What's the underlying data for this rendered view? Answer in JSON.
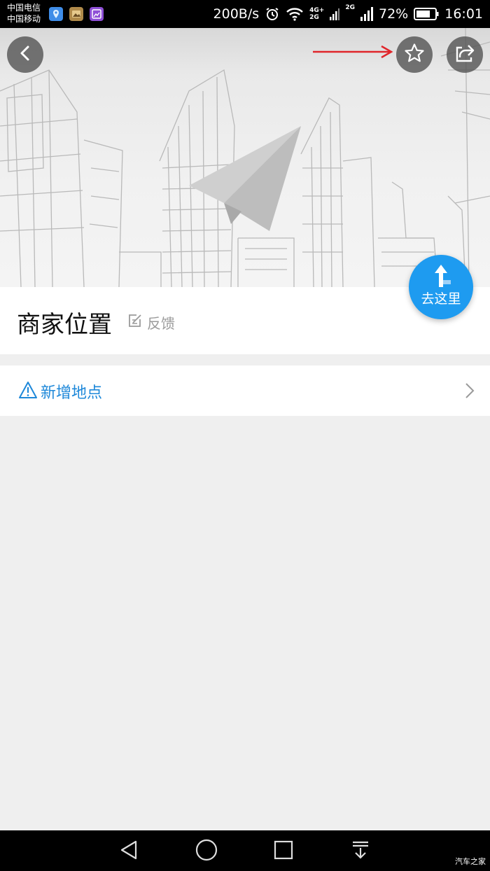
{
  "status_bar": {
    "carrier_1": "中国电信",
    "carrier_2": "中国移动",
    "net_speed": "200B/s",
    "net_4g": "4G+",
    "net_2g_a": "2G",
    "net_2g_b": "2G",
    "battery": "72%",
    "time": "16:01"
  },
  "place": {
    "title": "商家位置",
    "feedback_label": "反馈"
  },
  "go_button": {
    "label": "去这里"
  },
  "add_place": {
    "label": "新增地点"
  },
  "watermark": "汽车之家",
  "colors": {
    "accent": "#1e9bf0",
    "link": "#1e88d9",
    "annotation_arrow": "#e0262b"
  }
}
